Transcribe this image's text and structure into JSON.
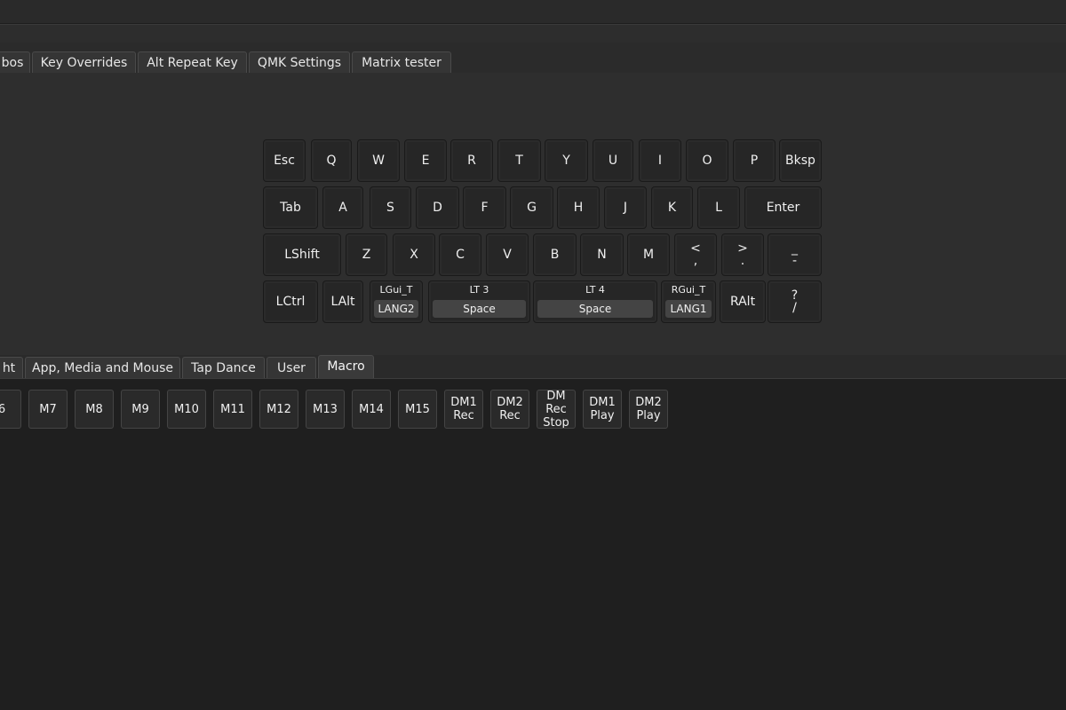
{
  "top_tabs": [
    "bos",
    "Key Overrides",
    "Alt Repeat Key",
    "QMK Settings",
    "Matrix tester"
  ],
  "keyboard": {
    "rows": [
      [
        "Esc",
        "Q",
        "W",
        "E",
        "R",
        "T",
        "Y",
        "U",
        "I",
        "O",
        "P",
        "Bksp"
      ],
      [
        "Tab",
        "A",
        "S",
        "D",
        "F",
        "G",
        "H",
        "J",
        "K",
        "L",
        "Enter"
      ],
      [
        "LShift",
        "Z",
        "X",
        "C",
        "V",
        "B",
        "N",
        "M",
        "<\n,",
        ">\n.",
        "_\n-"
      ],
      [
        "LCtrl",
        "LAlt",
        {
          "top": "LGui_T",
          "bottom": "LANG2"
        },
        {
          "top": "LT 3",
          "bottom": "Space"
        },
        {
          "top": "LT 4",
          "bottom": "Space"
        },
        {
          "top": "RGui_T",
          "bottom": "LANG1"
        },
        "RAlt",
        "?\n/"
      ]
    ]
  },
  "bottom_tabs": [
    "ht",
    "App, Media and Mouse",
    "Tap Dance",
    "User",
    "Macro"
  ],
  "active_bottom_tab": "Macro",
  "macro_keys": [
    "6",
    "M7",
    "M8",
    "M9",
    "M10",
    "M11",
    "M12",
    "M13",
    "M14",
    "M15",
    "DM1\nRec",
    "DM2\nRec",
    "DM Rec\nStop",
    "DM1\nPlay",
    "DM2\nPlay"
  ]
}
